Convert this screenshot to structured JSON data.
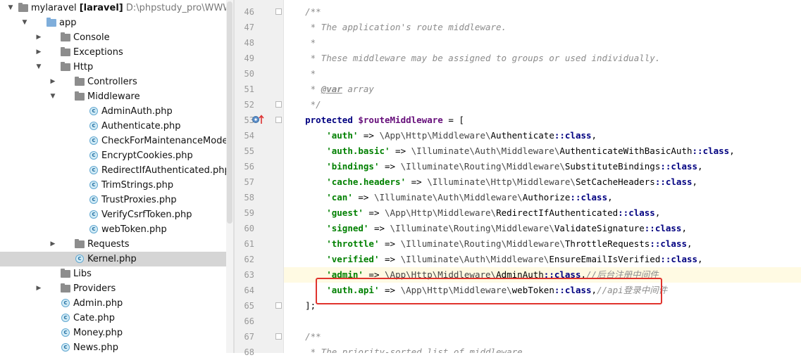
{
  "project": {
    "root_name": "mylaravel",
    "root_module": "[laravel]",
    "root_path": "D:\\phpstudy_pro\\WWW\\myla"
  },
  "tree": [
    {
      "label": "app",
      "type": "folder",
      "color": "blue",
      "indent": 1,
      "arrow": "down"
    },
    {
      "label": "Console",
      "type": "folder",
      "color": "grey",
      "indent": 2,
      "arrow": "right"
    },
    {
      "label": "Exceptions",
      "type": "folder",
      "color": "grey",
      "indent": 2,
      "arrow": "right"
    },
    {
      "label": "Http",
      "type": "folder",
      "color": "grey",
      "indent": 2,
      "arrow": "down"
    },
    {
      "label": "Controllers",
      "type": "folder",
      "color": "grey",
      "indent": 3,
      "arrow": "right"
    },
    {
      "label": "Middleware",
      "type": "folder",
      "color": "grey",
      "indent": 3,
      "arrow": "down"
    },
    {
      "label": "AdminAuth.php",
      "type": "php",
      "indent": 4
    },
    {
      "label": "Authenticate.php",
      "type": "php",
      "indent": 4
    },
    {
      "label": "CheckForMaintenanceMode.php",
      "type": "php",
      "indent": 4
    },
    {
      "label": "EncryptCookies.php",
      "type": "php",
      "indent": 4
    },
    {
      "label": "RedirectIfAuthenticated.php",
      "type": "php",
      "indent": 4
    },
    {
      "label": "TrimStrings.php",
      "type": "php",
      "indent": 4
    },
    {
      "label": "TrustProxies.php",
      "type": "php",
      "indent": 4
    },
    {
      "label": "VerifyCsrfToken.php",
      "type": "php",
      "indent": 4
    },
    {
      "label": "webToken.php",
      "type": "php",
      "indent": 4
    },
    {
      "label": "Requests",
      "type": "folder",
      "color": "grey",
      "indent": 3,
      "arrow": "right"
    },
    {
      "label": "Kernel.php",
      "type": "php",
      "indent": 3,
      "selected": true
    },
    {
      "label": "Libs",
      "type": "folder",
      "color": "grey",
      "indent": 2
    },
    {
      "label": "Providers",
      "type": "folder",
      "color": "grey",
      "indent": 2,
      "arrow": "right"
    },
    {
      "label": "Admin.php",
      "type": "php",
      "indent": 2
    },
    {
      "label": "Cate.php",
      "type": "php",
      "indent": 2
    },
    {
      "label": "Money.php",
      "type": "php",
      "indent": 2
    },
    {
      "label": "News.php",
      "type": "php",
      "indent": 2
    }
  ],
  "line_numbers": [
    "46",
    "47",
    "48",
    "49",
    "50",
    "51",
    "52",
    "53",
    "54",
    "55",
    "56",
    "57",
    "58",
    "59",
    "60",
    "61",
    "62",
    "63",
    "64",
    "65",
    "66",
    "67",
    "68"
  ],
  "code": {
    "l46": "/**",
    "l47": " * The application's route middleware.",
    "l48": " *",
    "l49": " * These middleware may be assigned to groups or used individually.",
    "l50": " *",
    "l51_pre": " * ",
    "l51_tag": "@var",
    "l51_post": " array",
    "l52": " */",
    "l53_kw": "protected",
    "l53_var": "$routeMiddleware",
    "l53_rest": " = [",
    "entries": [
      {
        "key": "'auth'",
        "ns": "\\App\\Http\\Middleware\\",
        "cls": "Authenticate",
        "comment": ""
      },
      {
        "key": "'auth.basic'",
        "ns": "\\Illuminate\\Auth\\Middleware\\",
        "cls": "AuthenticateWithBasicAuth",
        "comment": ""
      },
      {
        "key": "'bindings'",
        "ns": "\\Illuminate\\Routing\\Middleware\\",
        "cls": "SubstituteBindings",
        "comment": ""
      },
      {
        "key": "'cache.headers'",
        "ns": "\\Illuminate\\Http\\Middleware\\",
        "cls": "SetCacheHeaders",
        "comment": ""
      },
      {
        "key": "'can'",
        "ns": "\\Illuminate\\Auth\\Middleware\\",
        "cls": "Authorize",
        "comment": ""
      },
      {
        "key": "'guest'",
        "ns": "\\App\\Http\\Middleware\\",
        "cls": "RedirectIfAuthenticated",
        "comment": ""
      },
      {
        "key": "'signed'",
        "ns": "\\Illuminate\\Routing\\Middleware\\",
        "cls": "ValidateSignature",
        "comment": ""
      },
      {
        "key": "'throttle'",
        "ns": "\\Illuminate\\Routing\\Middleware\\",
        "cls": "ThrottleRequests",
        "comment": ""
      },
      {
        "key": "'verified'",
        "ns": "\\Illuminate\\Auth\\Middleware\\",
        "cls": "EnsureEmailIsVerified",
        "comment": ""
      },
      {
        "key": "'admin'",
        "ns": "\\App\\Http\\Middleware\\",
        "cls": "AdminAuth",
        "comment": "//后台注册中间件"
      },
      {
        "key": "'auth.api'",
        "ns": "\\App\\Http\\Middleware\\",
        "cls": "webToken",
        "comment": "//api登录中间件"
      }
    ],
    "arrow": " => ",
    "class_kw": "::class",
    "comma": ",",
    "l65": "];",
    "l66": "",
    "l67": "/**",
    "l68": " * The priority-sorted list of middleware."
  }
}
